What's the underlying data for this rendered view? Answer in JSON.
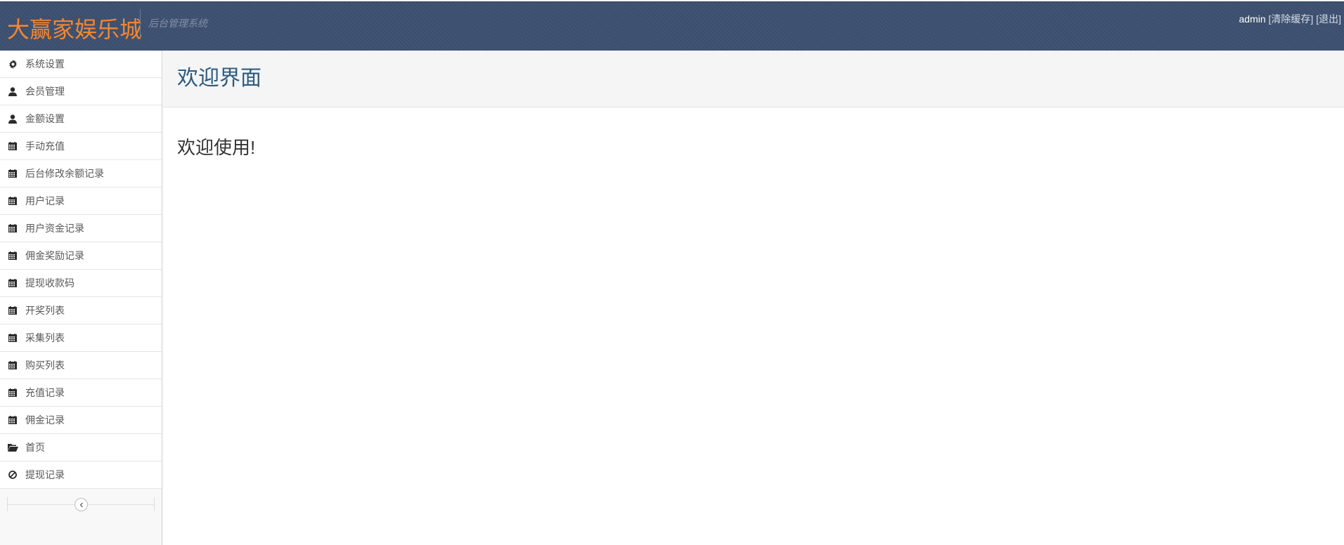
{
  "header": {
    "brand": "大赢家娱乐城",
    "subtitle": "后台管理系统",
    "user": "admin",
    "clear_cache": "[清除缓存]",
    "logout": "[退出]"
  },
  "sidebar": {
    "items": [
      {
        "label": "系统设置",
        "icon": "gear-icon"
      },
      {
        "label": "会员管理",
        "icon": "user-icon"
      },
      {
        "label": "金额设置",
        "icon": "user-icon"
      },
      {
        "label": "手动充值",
        "icon": "calendar-icon"
      },
      {
        "label": "后台修改余额记录",
        "icon": "calendar-icon"
      },
      {
        "label": "用户记录",
        "icon": "calendar-icon"
      },
      {
        "label": "用户资金记录",
        "icon": "calendar-icon"
      },
      {
        "label": "佣金奖励记录",
        "icon": "calendar-icon"
      },
      {
        "label": "提现收款码",
        "icon": "calendar-icon"
      },
      {
        "label": "开奖列表",
        "icon": "calendar-icon"
      },
      {
        "label": "采集列表",
        "icon": "calendar-icon"
      },
      {
        "label": "购买列表",
        "icon": "calendar-icon"
      },
      {
        "label": "充值记录",
        "icon": "calendar-icon"
      },
      {
        "label": "佣金记录",
        "icon": "calendar-icon"
      },
      {
        "label": "首页",
        "icon": "folder-open-icon"
      },
      {
        "label": "提现记录",
        "icon": "ban-icon"
      }
    ]
  },
  "main": {
    "title": "欢迎界面",
    "message": "欢迎使用!"
  },
  "colors": {
    "header_bg": "#3d5070",
    "brand": "#f38733",
    "title": "#2e5b80"
  }
}
